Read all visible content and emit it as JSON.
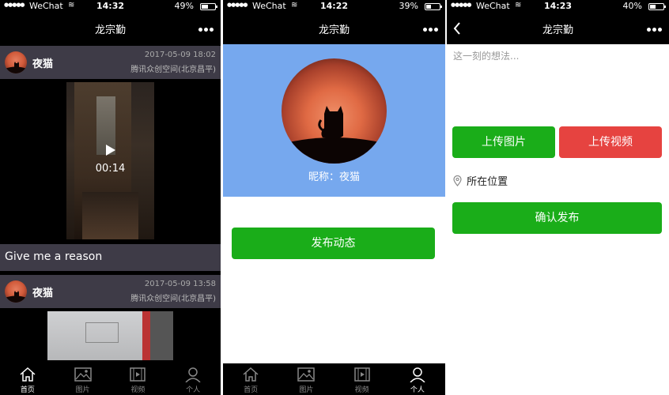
{
  "status_bars": [
    {
      "signal": "●●●●●",
      "carrier": "WeChat",
      "time": "14:32",
      "battery": "49%",
      "level": 0.49
    },
    {
      "signal": "●●●●●",
      "carrier": "WeChat",
      "time": "14:22",
      "battery": "39%",
      "level": 0.39
    },
    {
      "signal": "●●●●●",
      "carrier": "WeChat",
      "time": "14:23",
      "battery": "40%",
      "level": 0.4
    }
  ],
  "nav": {
    "title": "龙宗勤"
  },
  "feed": {
    "posts": [
      {
        "nickname": "夜猫",
        "date": "2017-05-09 18:02",
        "location": "腾讯众创空间(北京昌平)",
        "video_duration": "00:14",
        "caption": "Give me a reason"
      },
      {
        "nickname": "夜猫",
        "date": "2017-05-09 13:58",
        "location": "腾讯众创空间(北京昌平)"
      }
    ]
  },
  "tabs": [
    {
      "label": "首页",
      "icon": "home-icon"
    },
    {
      "label": "图片",
      "icon": "image-icon"
    },
    {
      "label": "视频",
      "icon": "video-icon"
    },
    {
      "label": "个人",
      "icon": "person-icon"
    }
  ],
  "profile": {
    "nickname_label": "昵称：夜猫",
    "post_button": "发布动态"
  },
  "compose": {
    "placeholder": "这一刻的想法...",
    "upload_image": "上传图片",
    "upload_video": "上传视频",
    "location": "所在位置",
    "confirm": "确认发布"
  },
  "colors": {
    "green": "#1aad19",
    "red": "#e64340",
    "profile_blue": "#76a8ee",
    "post_header": "#3e3b47"
  }
}
